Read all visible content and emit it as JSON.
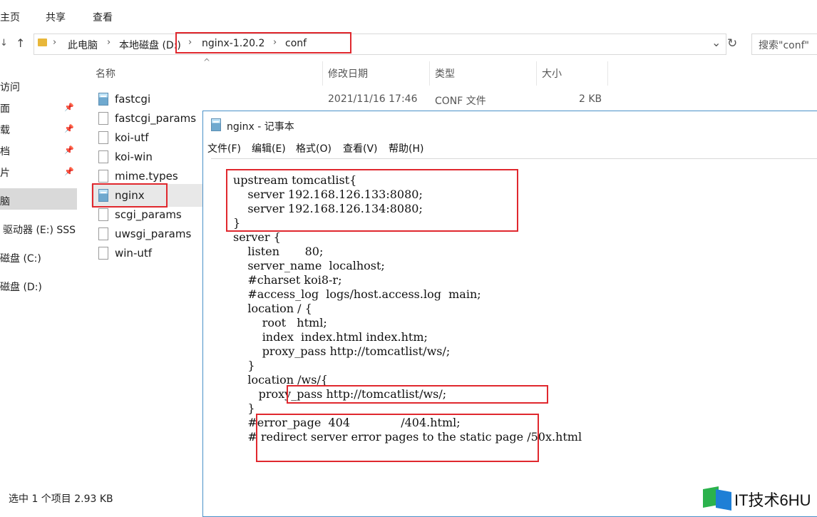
{
  "ribbon": {
    "tabs": [
      "主页",
      "共享",
      "查看"
    ]
  },
  "address": {
    "nav_back": "↓",
    "nav_up": "↑",
    "crumbs": [
      "此电脑",
      "本地磁盘 (D:)",
      "nginx-1.20.2",
      "conf"
    ],
    "dropdown": "⌄",
    "refresh": "↻"
  },
  "search": {
    "placeholder": "搜索\"conf\""
  },
  "nav": {
    "items": [
      "访问",
      "面",
      "载",
      "档",
      "片",
      "脑",
      "驱动器 (E:) SSS",
      "磁盘 (C:)",
      "磁盘 (D:)"
    ],
    "pin": "📌"
  },
  "columns": {
    "name": "名称",
    "date": "修改日期",
    "type": "类型",
    "size": "大小",
    "sort_indicator": "^"
  },
  "files": [
    {
      "name": "fastcgi",
      "icon": "notepad-file-icon"
    },
    {
      "name": "fastcgi_params",
      "icon": "file-icon"
    },
    {
      "name": "koi-utf",
      "icon": "file-icon"
    },
    {
      "name": "koi-win",
      "icon": "file-icon"
    },
    {
      "name": "mime.types",
      "icon": "file-icon"
    },
    {
      "name": "nginx",
      "icon": "notepad-file-icon"
    },
    {
      "name": "scgi_params",
      "icon": "file-icon"
    },
    {
      "name": "uwsgi_params",
      "icon": "file-icon"
    },
    {
      "name": "win-utf",
      "icon": "file-icon"
    }
  ],
  "first_row_meta": {
    "date": "2021/11/16 17:46",
    "type": "CONF 文件",
    "size": "2 KB"
  },
  "status": "选中 1 个项目  2.93 KB",
  "notepad": {
    "title": "nginx - 记事本",
    "menu": [
      "文件(F)",
      "编辑(E)",
      "格式(O)",
      "查看(V)",
      "帮助(H)"
    ],
    "code_lines": [
      "upstream tomcatlist{",
      "    server 192.168.126.133:8080;",
      "    server 192.168.126.134:8080;",
      "}",
      "server {",
      "    listen       80;",
      "    server_name  localhost;",
      "",
      "    #charset koi8-r;",
      "",
      "    #access_log  logs/host.access.log  main;",
      "",
      "    location / {",
      "        root   html;",
      "        index  index.html index.htm;",
      "        proxy_pass http://tomcatlist/ws/;",
      "    }",
      "    location /ws/{",
      "       proxy_pass http://tomcatlist/ws/;",
      "    }",
      "",
      "    #error_page  404              /404.html;",
      "",
      "    # redirect server error pages to the static page /50x.html"
    ]
  },
  "watermark": "IT技术6HU",
  "colors": {
    "annotation": "#e0282e",
    "accent": "#4a90c8"
  }
}
